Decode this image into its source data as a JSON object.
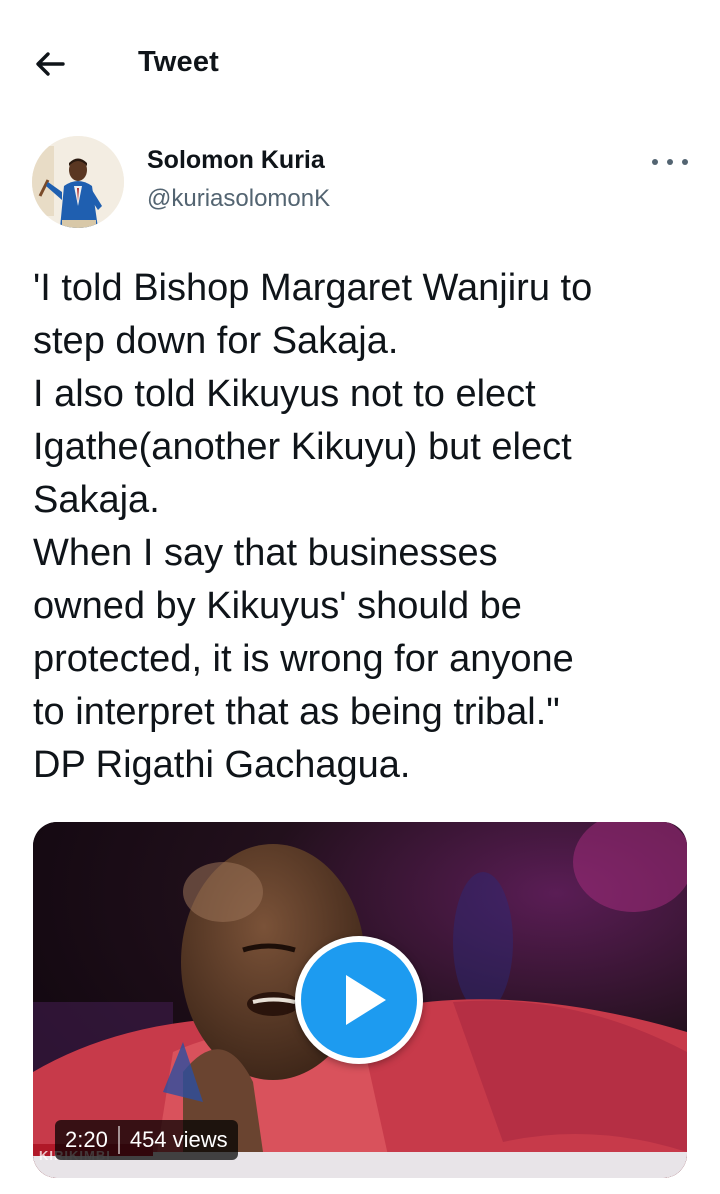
{
  "header": {
    "back_icon": "arrow-left-icon",
    "title": "Tweet"
  },
  "tweet": {
    "author": {
      "name": "Solomon Kuria",
      "handle": "@kuriasolomonK"
    },
    "more_icon": "more-horizontal-icon",
    "text": "'I told Bishop Margaret Wanjiru to\nstep down for Sakaja.\nI also told Kikuyus not to elect\nIgathe(another Kikuyu) but elect\nSakaja.\nWhen I say that businesses\nowned by Kikuyus' should be\nprotected, it is wrong for anyone\nto interpret that as being tribal.\"\nDP Rigathi Gachagua.",
    "media": {
      "type": "video",
      "play_icon": "play-icon",
      "duration": "2:20",
      "views": "454 views",
      "overlay_text": "KIRIKIMBI"
    }
  },
  "colors": {
    "accent": "#1d9bf0",
    "text_primary": "#0f1419",
    "text_secondary": "#536471"
  }
}
